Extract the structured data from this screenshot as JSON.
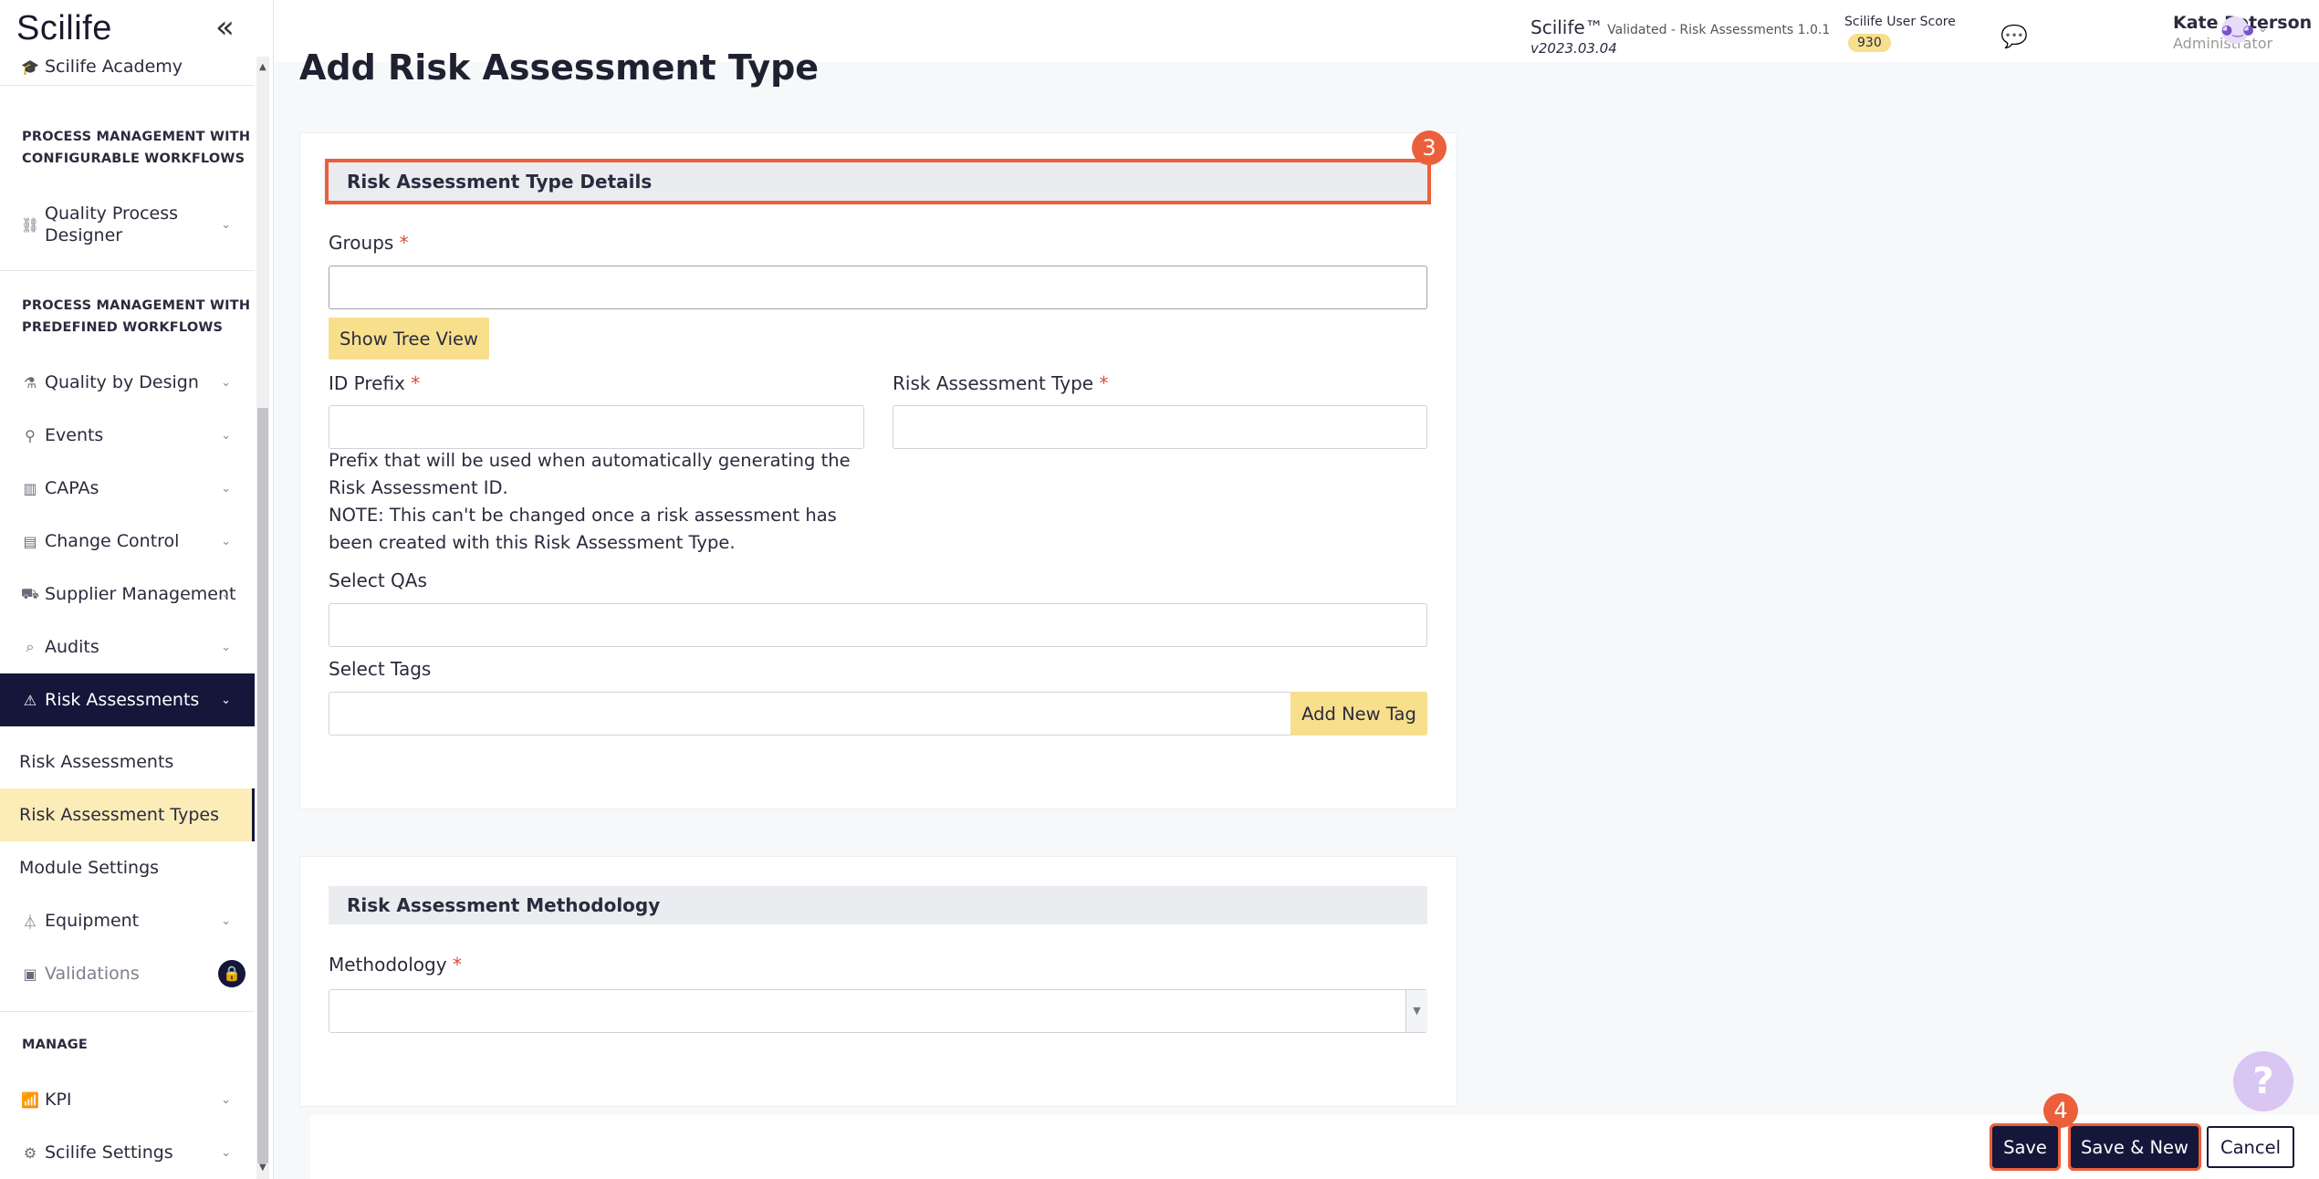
{
  "app": {
    "logo": "Scilife",
    "collapse_icon": "«"
  },
  "header": {
    "product_name": "Scilife™",
    "product_detail": " Validated - Risk Assessments 1.0.1",
    "version": "v2023.03.04",
    "score_label": "Scilife User Score",
    "score_value": "930",
    "user_name": "Kate Peterson",
    "user_role": "Administrator"
  },
  "sidebar": {
    "academy": "Scilife Academy",
    "section_configurable_1": "PROCESS MANAGEMENT WITH",
    "section_configurable_2": "CONFIGURABLE WORKFLOWS",
    "quality_process_designer_1": "Quality Process",
    "quality_process_designer_2": "Designer",
    "section_predefined_1": "PROCESS MANAGEMENT WITH",
    "section_predefined_2": "PREDEFINED WORKFLOWS",
    "items": {
      "quality_by_design": "Quality by Design",
      "events": "Events",
      "capas": "CAPAs",
      "change_control": "Change Control",
      "supplier_management": "Supplier Management",
      "audits": "Audits",
      "risk_assessments": "Risk Assessments",
      "sub_risk_assessments": "Risk Assessments",
      "sub_risk_assessment_types": "Risk Assessment Types",
      "sub_module_settings": "Module Settings",
      "equipment": "Equipment",
      "validations": "Validations"
    },
    "section_manage": "MANAGE",
    "kpi": "KPI",
    "scilife_settings": "Scilife Settings"
  },
  "main": {
    "page_title": "Add Risk Assessment Type",
    "details_header": "Risk Assessment Type Details",
    "details_step": "3",
    "groups_label": "Groups",
    "groups_value": "",
    "show_tree_view": "Show Tree View",
    "id_prefix_label": "ID Prefix",
    "id_prefix_value": "",
    "ra_type_label": "Risk Assessment Type",
    "ra_type_value": "",
    "help_line1": "Prefix that will be used when automatically generating the Risk Assessment ID.",
    "help_line2": "NOTE: This can't be changed once a risk assessment has been created with this Risk Assessment Type.",
    "select_qas_label": "Select QAs",
    "select_tags_label": "Select Tags",
    "add_new_tag": "Add New Tag",
    "methodology_header": "Risk Assessment Methodology",
    "methodology_label": "Methodology",
    "required_mark": "*"
  },
  "footer": {
    "step": "4",
    "save": "Save",
    "save_new": "Save & New",
    "cancel": "Cancel"
  },
  "help_bubble": "?",
  "colors": {
    "accent": "#14163a",
    "highlight": "#ec5f3b",
    "yellow": "#f7df8c"
  }
}
